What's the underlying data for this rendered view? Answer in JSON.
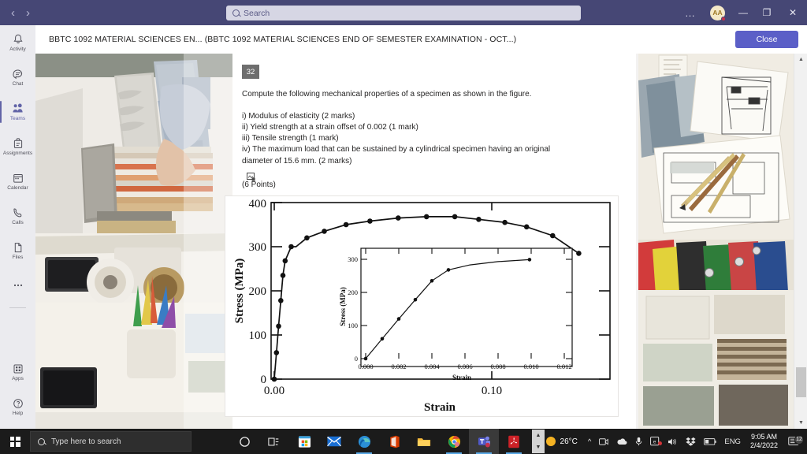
{
  "titlebar": {
    "back_label": "‹",
    "forward_label": "›",
    "search_placeholder": "Search",
    "overflow_label": "…",
    "avatar_initials": "AA",
    "minimize_label": "—",
    "maximize_label": "❐",
    "close_label": "✕"
  },
  "rail": {
    "items": [
      {
        "label": "Activity",
        "icon": "bell-icon"
      },
      {
        "label": "Chat",
        "icon": "chat-icon"
      },
      {
        "label": "Teams",
        "icon": "teams-icon"
      },
      {
        "label": "Assignments",
        "icon": "assignments-icon"
      },
      {
        "label": "Calendar",
        "icon": "calendar-icon"
      },
      {
        "label": "Calls",
        "icon": "calls-icon"
      },
      {
        "label": "Files",
        "icon": "files-icon"
      },
      {
        "label": "",
        "icon": "more-icon"
      }
    ],
    "bottom_items": [
      {
        "label": "Apps",
        "icon": "apps-icon"
      },
      {
        "label": "Help",
        "icon": "help-icon"
      }
    ]
  },
  "content_header": {
    "title": "BBTC 1092 MATERIAL SCIENCES EN... (BBTC 1092 MATERIAL SCIENCES END OF SEMESTER EXAMINATION - OCT...)",
    "close_label": "Close"
  },
  "question": {
    "number": "32",
    "prompt": "Compute the following mechanical properties of a specimen as shown in the figure.",
    "items": [
      "i) Modulus of elasticity (2 marks)",
      "ii) Yield strength at a strain offset of 0.002 (1 mark)",
      "iii) Tensile strength (1 mark)",
      "iv) The maximum load that can be sustained by a cylindrical specimen having an original",
      "diameter of 15.6 mm. (2 marks)"
    ],
    "attachment_icon": "image-attachment-icon",
    "points": "(6 Points)"
  },
  "chart_data": {
    "type": "line",
    "title": "",
    "xlabel": "Strain",
    "ylabel": "Stress (MPa)",
    "xlim": [
      0.0,
      0.155
    ],
    "ylim": [
      0,
      430
    ],
    "xticks": [
      0.0,
      0.1
    ],
    "xtick_labels": [
      "0.00",
      "0.10"
    ],
    "yticks": [
      0,
      100,
      200,
      300,
      400
    ],
    "ytick_labels": [
      "0",
      "100",
      "200",
      "300",
      "400"
    ],
    "grid": false,
    "legend": "none",
    "markers": true,
    "x": [
      0.0,
      0.001,
      0.002,
      0.003,
      0.004,
      0.005,
      0.0078,
      0.01,
      0.015,
      0.023,
      0.033,
      0.044,
      0.057,
      0.07,
      0.083,
      0.094,
      0.106,
      0.116,
      0.128,
      0.14
    ],
    "y": [
      0,
      60,
      120,
      178,
      235,
      268,
      300,
      300,
      320,
      335,
      350,
      358,
      365,
      368,
      368,
      362,
      355,
      345,
      325,
      285
    ],
    "inset": {
      "type": "line",
      "xlabel": "Strain",
      "ylabel": "Stress (MPa)",
      "xlim": [
        0.0,
        0.0125
      ],
      "ylim": [
        0,
        320
      ],
      "xticks": [
        0.0,
        0.002,
        0.004,
        0.006,
        0.008,
        0.01,
        0.012
      ],
      "xtick_labels": [
        "0.000",
        "0.002",
        "0.004",
        "0.006",
        "0.008",
        "0.010",
        "0.012"
      ],
      "yticks": [
        0,
        100,
        200,
        300
      ],
      "ytick_labels": [
        "0",
        "100",
        "200",
        "300"
      ],
      "x": [
        0.0,
        0.001,
        0.002,
        0.003,
        0.004,
        0.005,
        0.0063,
        0.008,
        0.0099
      ],
      "y": [
        0,
        60,
        120,
        178,
        235,
        268,
        283,
        293,
        299
      ]
    }
  },
  "scrollbar": {
    "up_label": "▲",
    "down_label": "▼"
  },
  "taskbar": {
    "search_placeholder": "Type here to search",
    "cortana_label": "cortana-icon",
    "taskview_label": "task-view-icon",
    "apps": [
      "microsoft-store-icon",
      "mail-icon",
      "edge-icon",
      "office-icon",
      "file-explorer-icon",
      "chrome-icon",
      "teams-icon",
      "acrobat-reader-icon"
    ],
    "weather_temp": "26°C",
    "tray": [
      "show-hidden-icons-chevron",
      "camera-icon",
      "onedrive-icon",
      "microphone-icon",
      "screen-capture-icon",
      "volume-icon",
      "dropbox-icon",
      "battery-icon"
    ],
    "language": "ENG",
    "time": "9:05 AM",
    "date": "2/4/2022",
    "notification_count": "12"
  }
}
